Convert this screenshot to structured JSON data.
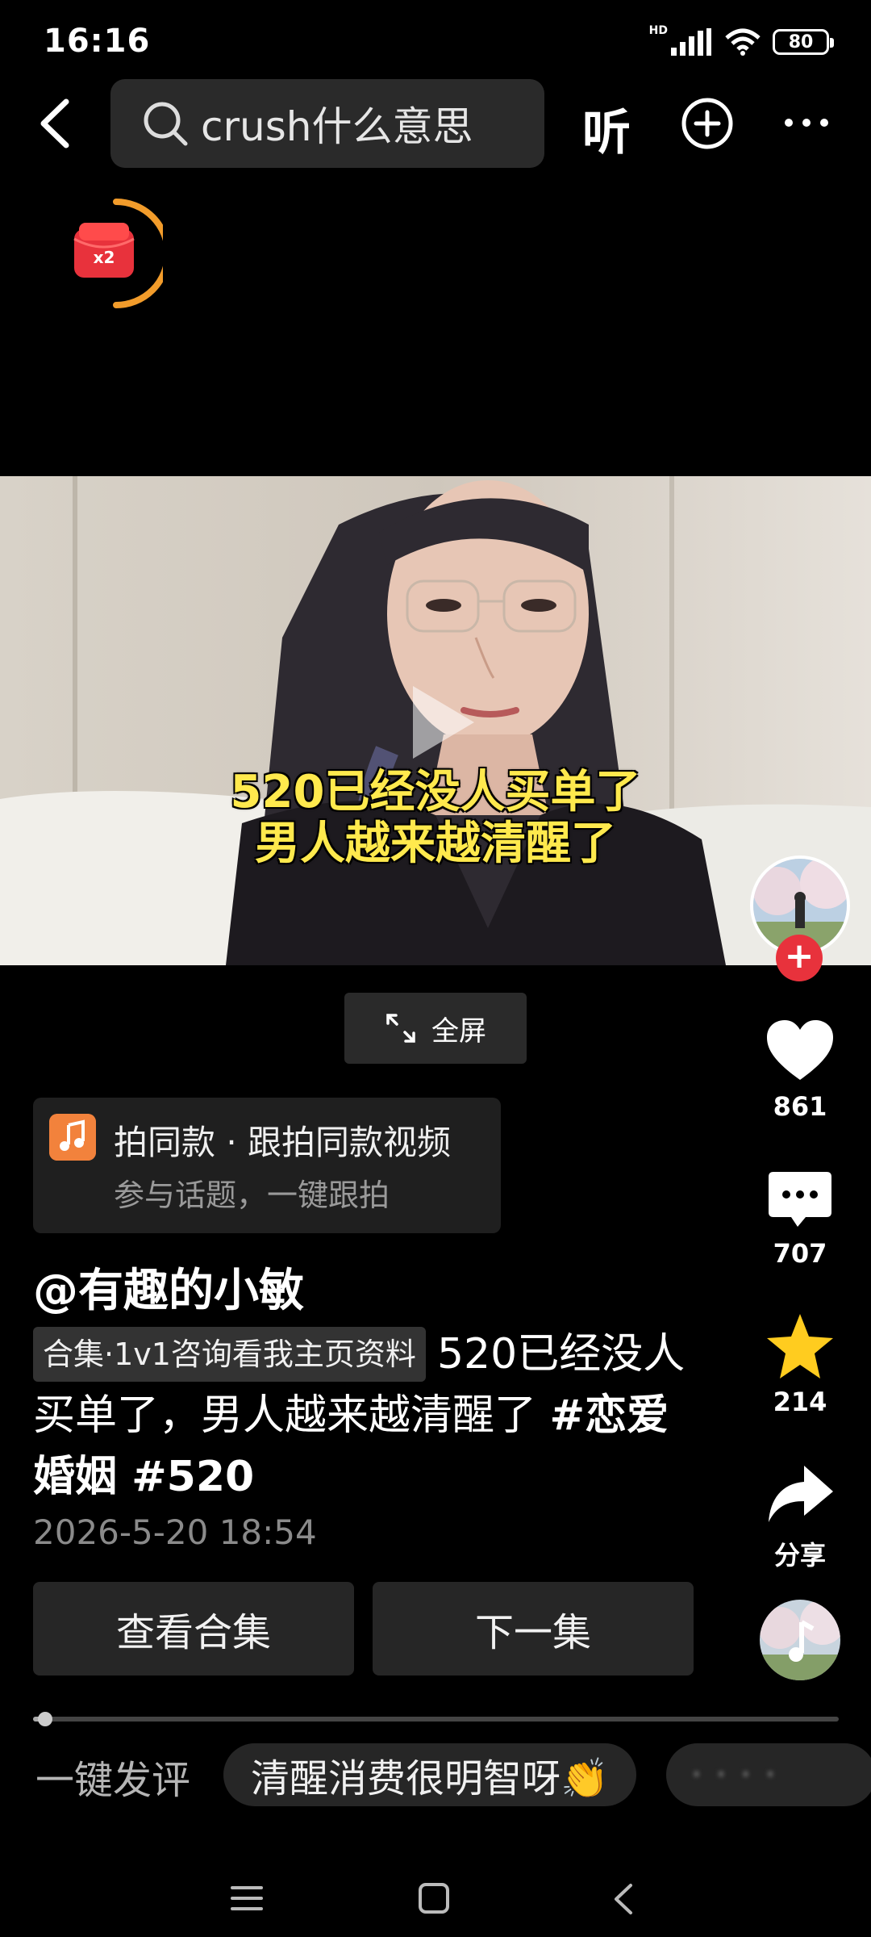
{
  "status_bar": {
    "time": "16:16",
    "network_label": "HD",
    "battery": "80"
  },
  "top_bar": {
    "search_text": "crush什么意思",
    "listen_label": "听"
  },
  "red_packet": {
    "badge": "x2"
  },
  "video": {
    "caption_line1": "520已经没人买单了",
    "caption_line2": "男人越来越清醒了"
  },
  "fullscreen_label": "全屏",
  "right_rail": {
    "likes": "861",
    "comments": "707",
    "favorites": "214",
    "share_label": "分享"
  },
  "same_style": {
    "title": "拍同款 · 跟拍同款视频",
    "subtitle": "参与话题，一键跟拍"
  },
  "author": {
    "name": "@有趣的小敏"
  },
  "description": {
    "collection_tag": "合集·1v1咨询看我主页资料",
    "text": "520已经没人买单了，男人越来越清醒了 ",
    "hashtags": "#恋爱婚姻 #520"
  },
  "post_date": "2026-5-20 18:54",
  "buttons": {
    "view_collection": "查看合集",
    "next_episode": "下一集"
  },
  "progress": {
    "fraction": 0.015
  },
  "quick_comment": {
    "label": "一键发评",
    "chips": [
      "清醒消费很明智呀👏"
    ]
  },
  "colors": {
    "like_red": "#e8323c",
    "star_yellow": "#ffcc1f",
    "caption_yellow": "#ffe94d",
    "music_orange": "#f2823c"
  }
}
